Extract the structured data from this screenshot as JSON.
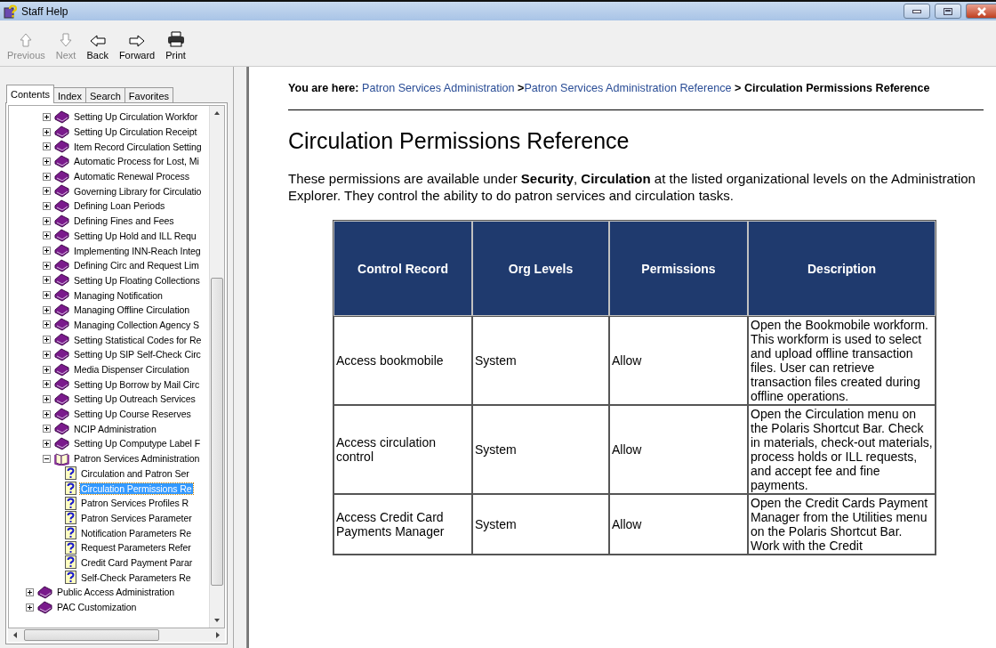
{
  "window": {
    "title": "Staff Help"
  },
  "toolbar": [
    {
      "label": "Previous",
      "kind": "up",
      "disabled": true
    },
    {
      "label": "Next",
      "kind": "down",
      "disabled": true
    },
    {
      "label": "Back",
      "kind": "left",
      "disabled": false
    },
    {
      "label": "Forward",
      "kind": "right",
      "disabled": false
    },
    {
      "label": "Print",
      "kind": "print",
      "disabled": false
    }
  ],
  "tabs": [
    {
      "label": "Contents",
      "selected": true
    },
    {
      "label": "Index",
      "selected": false
    },
    {
      "label": "Search",
      "selected": false
    },
    {
      "label": "Favorites",
      "selected": false
    }
  ],
  "tree": {
    "scrolled_branch": {
      "children": [
        {
          "label": "Setting Up Circulation Workfor",
          "kind": "book",
          "expanded": false
        },
        {
          "label": "Setting Up Circulation Receipt",
          "kind": "book",
          "expanded": false
        },
        {
          "label": "Item Record Circulation Setting",
          "kind": "book",
          "expanded": false
        },
        {
          "label": "Automatic Process for Lost, Mi",
          "kind": "book",
          "expanded": false
        },
        {
          "label": "Automatic Renewal Process",
          "kind": "book",
          "expanded": false
        },
        {
          "label": "Governing Library for Circulatio",
          "kind": "book",
          "expanded": false
        },
        {
          "label": "Defining Loan Periods",
          "kind": "book",
          "expanded": false
        },
        {
          "label": "Defining Fines and Fees",
          "kind": "book",
          "expanded": false
        },
        {
          "label": "Setting Up Hold and ILL Requ",
          "kind": "book",
          "expanded": false
        },
        {
          "label": "Implementing INN-Reach Integ",
          "kind": "book",
          "expanded": false
        },
        {
          "label": "Defining Circ and Request Lim",
          "kind": "book",
          "expanded": false
        },
        {
          "label": "Setting Up Floating Collections",
          "kind": "book",
          "expanded": false
        },
        {
          "label": "Managing Notification",
          "kind": "book",
          "expanded": false
        },
        {
          "label": "Managing Offline Circulation",
          "kind": "book",
          "expanded": false
        },
        {
          "label": "Managing Collection Agency S",
          "kind": "book",
          "expanded": false
        },
        {
          "label": "Setting Statistical Codes for Re",
          "kind": "book",
          "expanded": false
        },
        {
          "label": "Setting Up SIP Self-Check Circ",
          "kind": "book",
          "expanded": false
        },
        {
          "label": "Media Dispenser Circulation",
          "kind": "book",
          "expanded": false
        },
        {
          "label": "Setting Up Borrow by Mail Circ",
          "kind": "book",
          "expanded": false
        },
        {
          "label": "Setting Up Outreach Services",
          "kind": "book",
          "expanded": false
        },
        {
          "label": "Setting Up Course Reserves",
          "kind": "book",
          "expanded": false
        },
        {
          "label": "NCIP Administration",
          "kind": "book",
          "expanded": false
        },
        {
          "label": "Setting Up Computype Label F",
          "kind": "book",
          "expanded": false
        },
        {
          "label": "Patron Services Administration",
          "kind": "book",
          "expanded": true,
          "children": [
            {
              "label": "Circulation and Patron Ser",
              "kind": "page",
              "selected": false
            },
            {
              "label": "Circulation Permissions Re",
              "kind": "page",
              "selected": true
            },
            {
              "label": "Patron Services Profiles R",
              "kind": "page",
              "selected": false
            },
            {
              "label": "Patron Services Parameter",
              "kind": "page",
              "selected": false
            },
            {
              "label": "Notification Parameters Re",
              "kind": "page",
              "selected": false
            },
            {
              "label": "Request Parameters Refer",
              "kind": "page",
              "selected": false
            },
            {
              "label": "Credit Card Payment Parar",
              "kind": "page",
              "selected": false
            },
            {
              "label": "Self-Check Parameters Re",
              "kind": "page",
              "selected": false
            }
          ]
        }
      ]
    },
    "items": [
      {
        "label": "Public Access Administration",
        "kind": "book",
        "expanded": false
      },
      {
        "label": "PAC Customization",
        "kind": "book",
        "expanded": false
      }
    ]
  },
  "breadcrumb": {
    "prefix": "You are here:",
    "links": [
      "Patron Services Administration",
      "Patron Services Administration Reference"
    ],
    "current": "Circulation Permissions Reference",
    "separator": ">"
  },
  "heading": "Circulation Permissions Reference",
  "intro": "These permissions are available under **Security**, **Circulation** at the listed organizational levels on the Administration Explorer. They control the ability to do patron services and circulation tasks.",
  "table": {
    "columns": [
      "Control Record",
      "Org Levels",
      "Permissions",
      "Description"
    ],
    "rows": [
      [
        "Access bookmobile",
        "System",
        "Allow",
        "Open the Bookmobile workform. This workform is used to select and upload offline transaction files. User can retrieve transaction files created during offline operations."
      ],
      [
        "Access circulation control",
        "System",
        "Allow",
        "Open the Circulation menu on the Polaris Shortcut Bar. Check in materials, check-out materials, process holds or ILL requests, and accept fee and fine payments."
      ],
      [
        "Access Credit Card Payments Manager",
        "System",
        "Allow",
        "Open the Credit Cards Payment Manager from the Utilities menu on the Polaris Shortcut Bar. Work with the Credit"
      ]
    ]
  }
}
